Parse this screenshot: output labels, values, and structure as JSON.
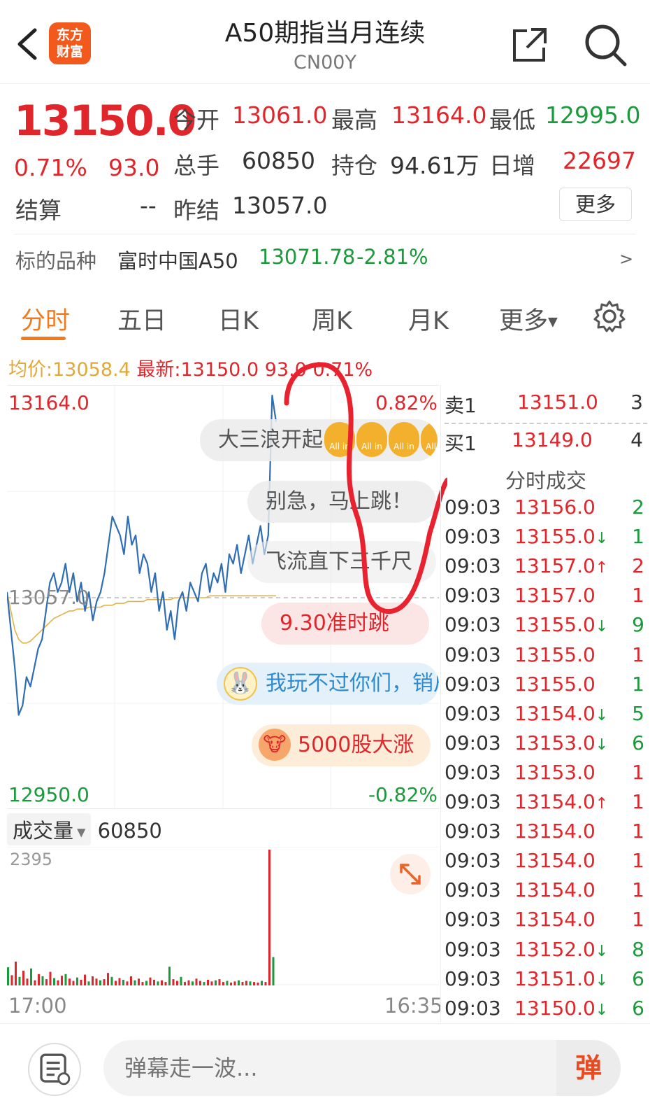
{
  "header": {
    "logo_line1": "东方",
    "logo_line2": "财富",
    "title": "A50期指当月连续",
    "code": "CN00Y"
  },
  "quote": {
    "price": "13150.0",
    "change_pct": "0.71%",
    "change": "93.0",
    "open_label": "今开",
    "open": "13061.0",
    "high_label": "最高",
    "high": "13164.0",
    "low_label": "最低",
    "low": "12995.0",
    "volume_label": "总手",
    "volume": "60850",
    "oi_label": "持仓",
    "oi": "94.61万",
    "daily_inc_label": "日增",
    "daily_inc": "22697",
    "settle_label": "结算",
    "settle": "--",
    "prev_settle_label": "昨结",
    "prev_settle": "13057.0",
    "more_label": "更多"
  },
  "underlying": {
    "label": "标的品种",
    "name": "富时中国A50",
    "price": "13071.78",
    "change_pct": "-2.81%",
    "arrow": ">"
  },
  "tabs": [
    "分时",
    "五日",
    "日K",
    "周K",
    "月K",
    "更多"
  ],
  "avg_line": {
    "avg_label": "均价:",
    "avg": "13058.4",
    "latest_label": "最新:",
    "latest": "13150.0",
    "change": "93.0",
    "pct": "0.71%"
  },
  "chart_data": {
    "type": "line",
    "x_start": "17:00",
    "x_end": "16:35",
    "y_max_label": "13164.0",
    "y_min_label": "12950.0",
    "y_ref_label": "13057.0",
    "pct_max_label": "0.82%",
    "pct_min_label": "-0.82%",
    "ylim": [
      12950,
      13164
    ],
    "reference": 13057,
    "series": [
      {
        "values": [
          13060,
          13040,
          13020,
          12995,
          13000,
          13015,
          13010,
          13020,
          13030,
          13035,
          13050,
          13065,
          13070,
          13060,
          13065,
          13075,
          13060,
          13070,
          13055,
          13065,
          13050,
          13060,
          13045,
          13055,
          13060,
          13070,
          13085,
          13100,
          13095,
          13090,
          13080,
          13100,
          13085,
          13090,
          13070,
          13080,
          13075,
          13060,
          13070,
          13050,
          13060,
          13040,
          13050,
          13035,
          13055,
          13060,
          13050,
          13065,
          13060,
          13055,
          13070,
          13075,
          13060,
          13070,
          13065,
          13075,
          13060,
          13080,
          13075,
          13085,
          13070,
          13080,
          13090,
          13075,
          13085,
          13095,
          13080,
          13090,
          13164,
          13150
        ]
      },
      {
        "values": [
          13060,
          13050,
          13040,
          13035,
          13033,
          13033,
          13034,
          13036,
          13038,
          13040,
          13042,
          13044,
          13046,
          13047,
          13048,
          13049,
          13050,
          13050,
          13051,
          13051,
          13051,
          13052,
          13052,
          13052,
          13052,
          13053,
          13053,
          13053,
          13054,
          13054,
          13054,
          13055,
          13055,
          13055,
          13055,
          13055,
          13056,
          13056,
          13056,
          13056,
          13056,
          13056,
          13056,
          13057,
          13057,
          13057,
          13057,
          13057,
          13057,
          13057,
          13057,
          13057,
          13058,
          13058,
          13058,
          13058,
          13058,
          13058,
          13058,
          13058,
          13058,
          13058,
          13058,
          13058,
          13058,
          13058,
          13058,
          13058,
          13058,
          13058
        ]
      }
    ]
  },
  "danmu": [
    {
      "text": "大三浪开起"
    },
    {
      "text": "别急，马上跳！"
    },
    {
      "text": "飞流直下三千尺"
    },
    {
      "text": "9.30准时跳"
    },
    {
      "text": "我玩不过你们，销户"
    },
    {
      "text": "5000股大涨"
    }
  ],
  "allin_label": "All in",
  "volume_chart": {
    "type": "bar",
    "header_label": "成交量",
    "total": "60850",
    "max_label": "2395",
    "ylim": [
      0,
      2395
    ],
    "values": [
      320,
      180,
      420,
      150,
      260,
      120,
      300,
      90,
      200,
      160,
      110,
      240,
      130,
      90,
      170,
      200,
      120,
      80,
      140,
      100,
      190,
      70,
      160,
      120,
      90,
      110,
      220,
      150,
      80,
      130,
      100,
      70,
      160,
      90,
      120,
      60,
      80,
      140,
      100,
      70,
      90,
      60,
      330,
      110,
      80,
      150,
      60,
      90,
      70,
      120,
      80,
      60,
      100,
      70,
      90,
      110,
      60,
      80,
      50,
      70,
      90,
      60,
      80,
      70,
      60,
      50,
      80,
      60,
      2395,
      500
    ]
  },
  "orderbook": {
    "sell_label": "卖1",
    "sell_price": "13151.0",
    "sell_qty": "3",
    "buy_label": "买1",
    "buy_price": "13149.0",
    "buy_qty": "4",
    "trades_title": "分时成交"
  },
  "trades": [
    {
      "time": "09:03",
      "price": "13156.0",
      "dir": "",
      "qty": "2",
      "qcolor": "green"
    },
    {
      "time": "09:03",
      "price": "13155.0",
      "dir": "↓",
      "qty": "1",
      "qcolor": "green"
    },
    {
      "time": "09:03",
      "price": "13157.0",
      "dir": "↑",
      "qty": "2",
      "qcolor": "red"
    },
    {
      "time": "09:03",
      "price": "13157.0",
      "dir": "",
      "qty": "1",
      "qcolor": "red"
    },
    {
      "time": "09:03",
      "price": "13155.0",
      "dir": "↓",
      "qty": "9",
      "qcolor": "green"
    },
    {
      "time": "09:03",
      "price": "13155.0",
      "dir": "",
      "qty": "1",
      "qcolor": "red"
    },
    {
      "time": "09:03",
      "price": "13155.0",
      "dir": "",
      "qty": "1",
      "qcolor": "green"
    },
    {
      "time": "09:03",
      "price": "13154.0",
      "dir": "↓",
      "qty": "5",
      "qcolor": "green"
    },
    {
      "time": "09:03",
      "price": "13153.0",
      "dir": "↓",
      "qty": "6",
      "qcolor": "green"
    },
    {
      "time": "09:03",
      "price": "13153.0",
      "dir": "",
      "qty": "1",
      "qcolor": "red"
    },
    {
      "time": "09:03",
      "price": "13154.0",
      "dir": "↑",
      "qty": "1",
      "qcolor": "red"
    },
    {
      "time": "09:03",
      "price": "13154.0",
      "dir": "",
      "qty": "1",
      "qcolor": "red"
    },
    {
      "time": "09:03",
      "price": "13154.0",
      "dir": "",
      "qty": "1",
      "qcolor": "red"
    },
    {
      "time": "09:03",
      "price": "13154.0",
      "dir": "",
      "qty": "1",
      "qcolor": "red"
    },
    {
      "time": "09:03",
      "price": "13154.0",
      "dir": "",
      "qty": "1",
      "qcolor": "red"
    },
    {
      "time": "09:03",
      "price": "13152.0",
      "dir": "↓",
      "qty": "8",
      "qcolor": "green"
    },
    {
      "time": "09:03",
      "price": "13151.0",
      "dir": "↓",
      "qty": "6",
      "qcolor": "green"
    },
    {
      "time": "09:03",
      "price": "13150.0",
      "dir": "↓",
      "qty": "6",
      "qcolor": "green"
    }
  ],
  "bottom": {
    "placeholder": "弹幕走一波...",
    "send_label": "弹"
  },
  "colors": {
    "up": "#e0262b",
    "down": "#1a9a3b",
    "accent": "#f07b1e",
    "price_line": "#2f6db5",
    "avg_line": "#e2b24a",
    "annotation": "#e8232f"
  }
}
